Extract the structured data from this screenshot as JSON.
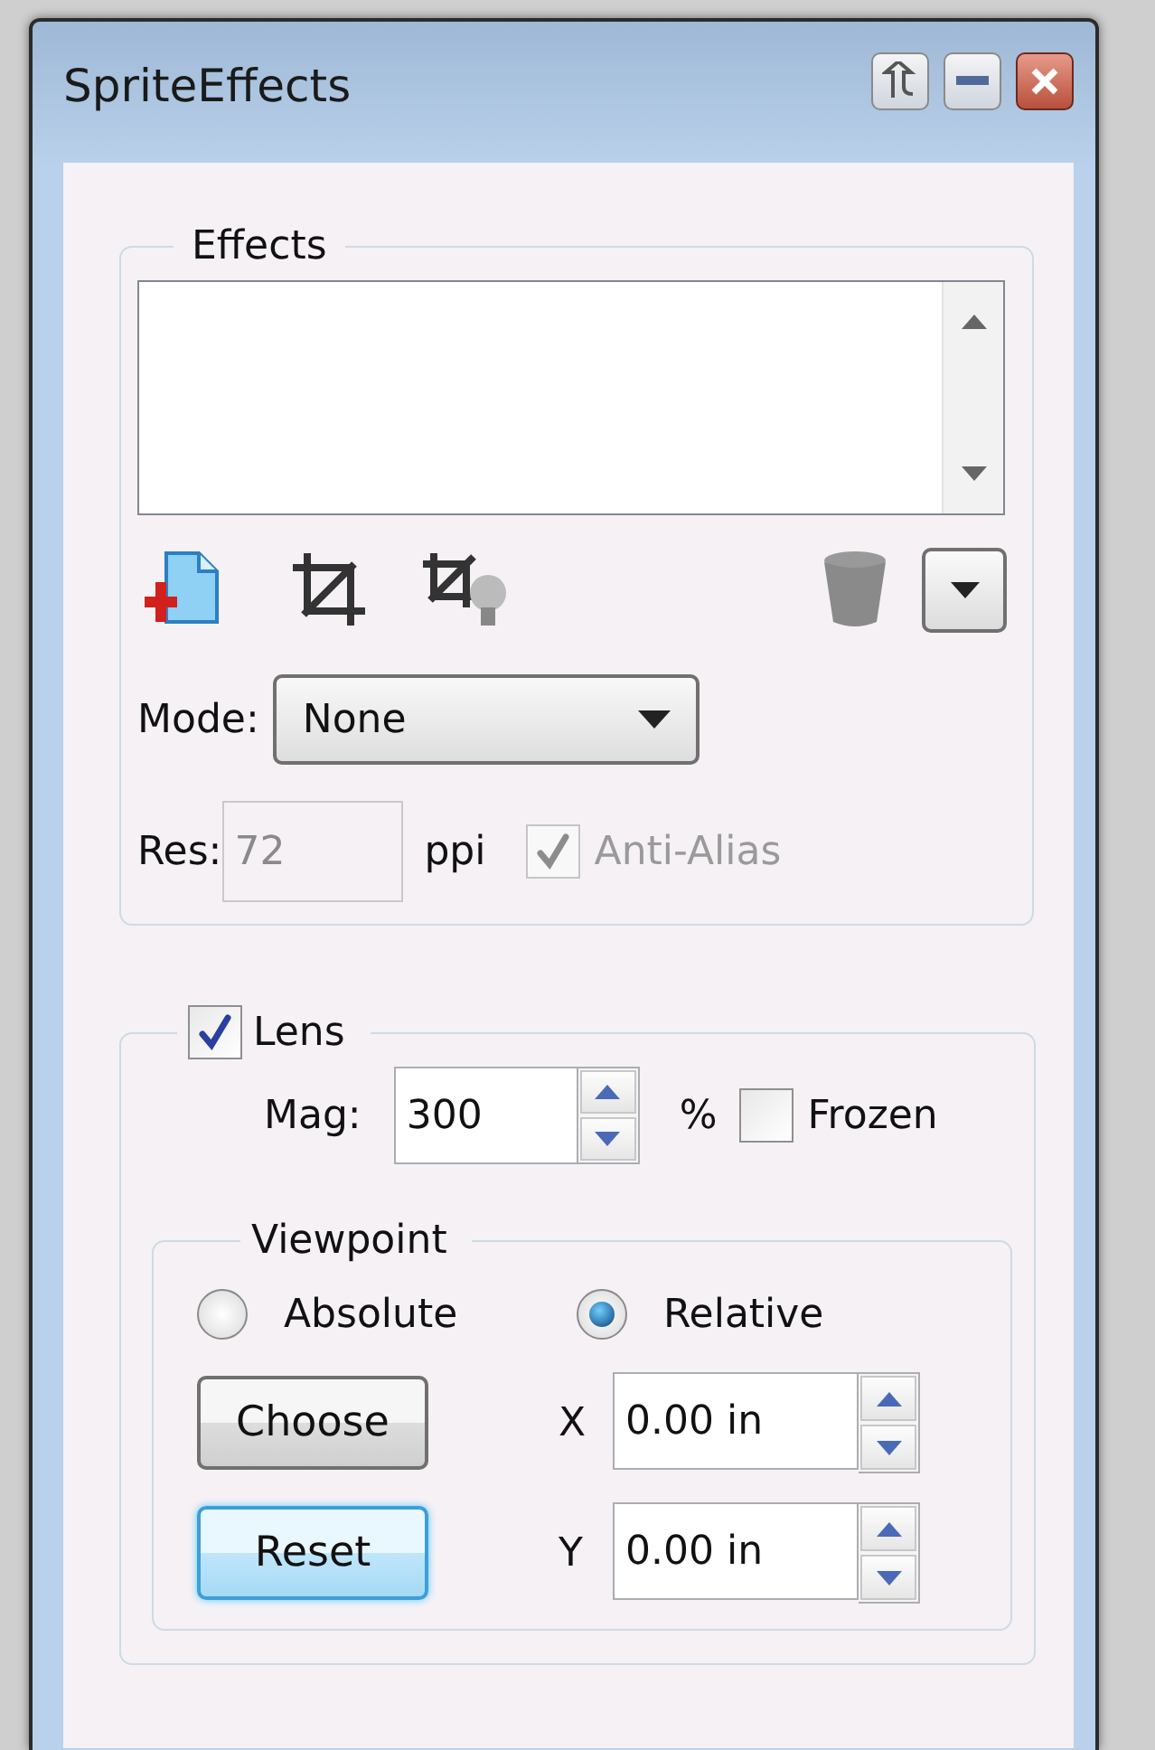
{
  "window": {
    "title": "SpriteEffects"
  },
  "effects": {
    "title": "Effects",
    "mode": {
      "label": "Mode:",
      "value": "None"
    },
    "res": {
      "label": "Res:",
      "value": "72",
      "unit": "ppi",
      "disabled": true
    },
    "anti_alias": {
      "label": "Anti-Alias",
      "checked": true,
      "disabled": true
    }
  },
  "lens": {
    "label": "Lens",
    "checked": true,
    "mag": {
      "label": "Mag:",
      "value": "300",
      "unit": "%"
    },
    "frozen": {
      "label": "Frozen",
      "checked": false
    },
    "viewpoint": {
      "title": "Viewpoint",
      "options": [
        {
          "label": "Absolute",
          "selected": false
        },
        {
          "label": "Relative",
          "selected": true
        }
      ],
      "buttons": [
        {
          "label": "Choose",
          "focused": false
        },
        {
          "label": "Reset",
          "focused": true
        }
      ],
      "coords": [
        {
          "label": "X",
          "value": "0.00 in"
        },
        {
          "label": "Y",
          "value": "0.00 in"
        }
      ]
    }
  }
}
